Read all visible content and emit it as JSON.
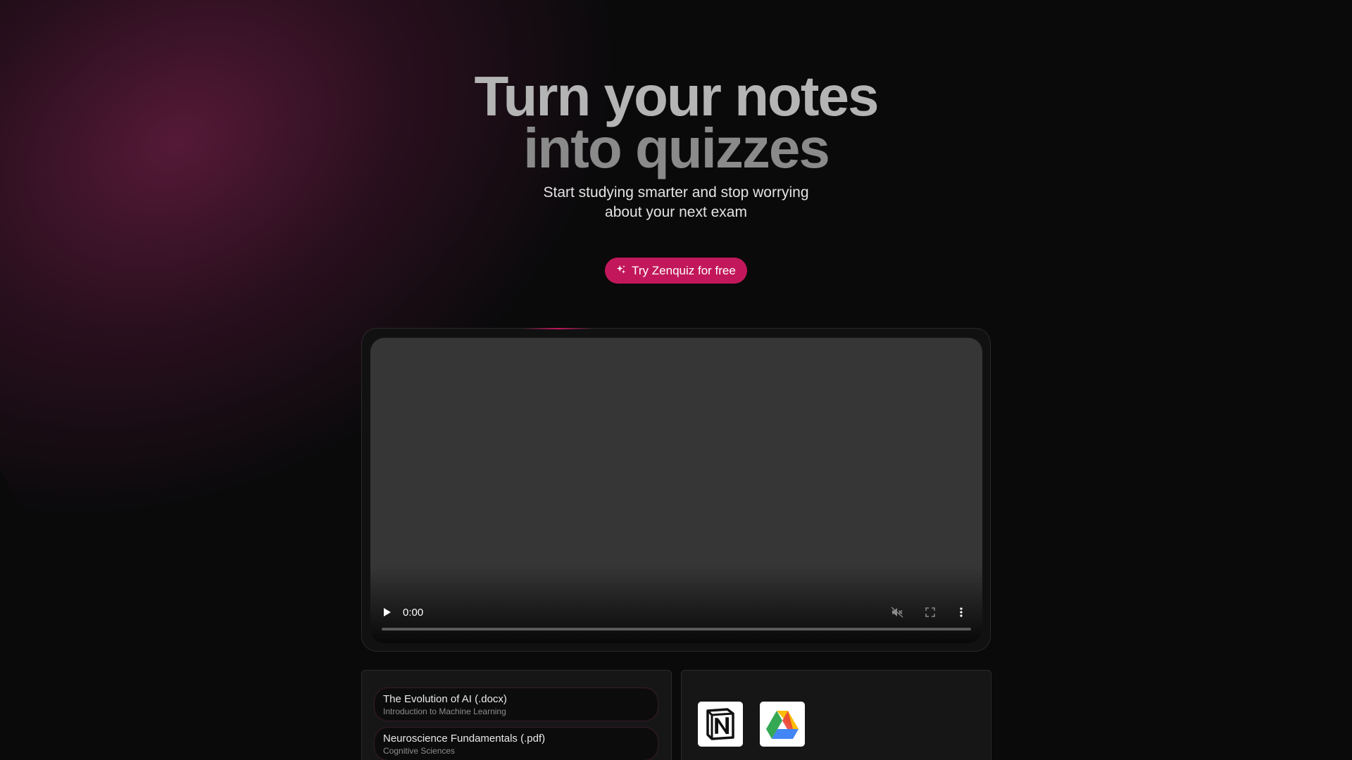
{
  "hero": {
    "title_line1": "Turn your notes",
    "title_line2": "into quizzes",
    "subtitle": "Start studying smarter and stop worrying about your next exam",
    "cta_label": "Try Zenquiz for free"
  },
  "video": {
    "current_time": "0:00",
    "progress": 0,
    "muted": true
  },
  "documents": [
    {
      "name": "The Evolution of AI (.docx)",
      "course": "Introduction to Machine Learning"
    },
    {
      "name": "Neuroscience Fundamentals (.pdf)",
      "course": "Cognitive Sciences"
    }
  ],
  "integrations": [
    {
      "icon": "notion-icon"
    },
    {
      "icon": "google-drive-icon"
    }
  ],
  "colors": {
    "background": "#0a0a0b",
    "accent": "#c2185b",
    "glow": "#6e1e46",
    "video_surface": "#363637"
  }
}
